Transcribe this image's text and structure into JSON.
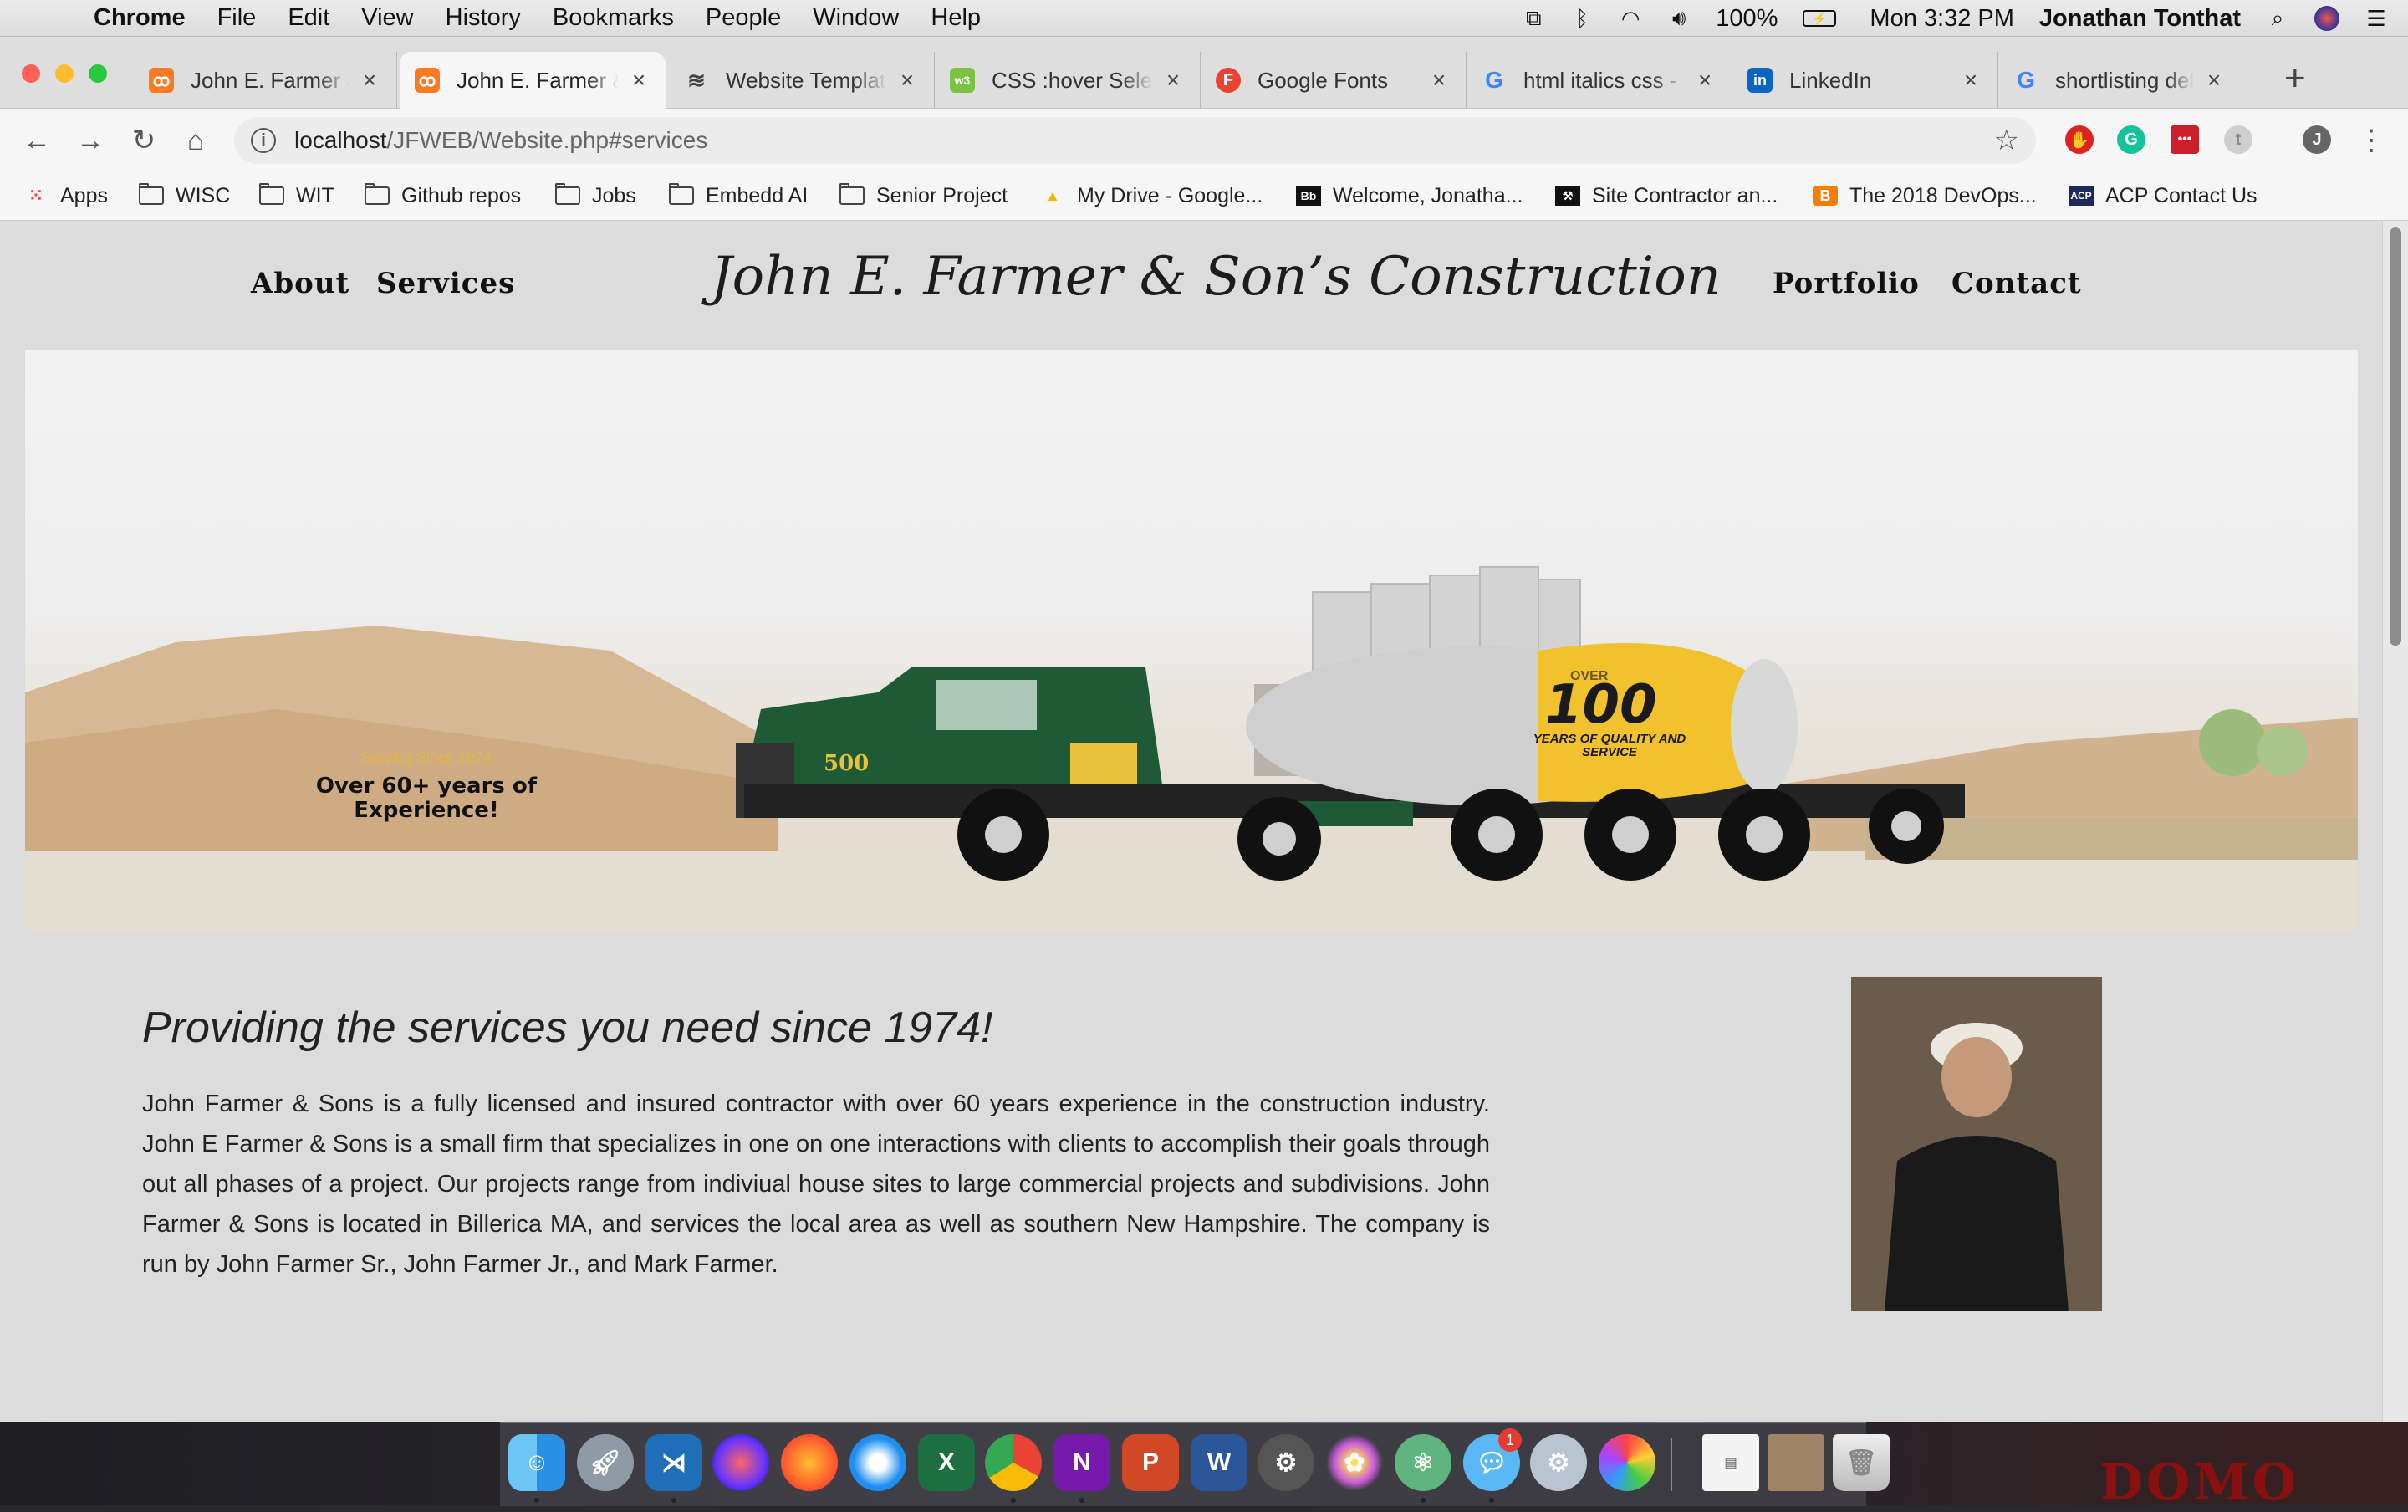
{
  "menubar": {
    "app": "Chrome",
    "items": [
      "File",
      "Edit",
      "View",
      "History",
      "Bookmarks",
      "People",
      "Window",
      "Help"
    ],
    "battery": "100%",
    "clock": "Mon 3:32 PM",
    "user": "Jonathan Tonthat"
  },
  "tabs": [
    {
      "title": "John E. Farmer &",
      "favicon": "xampp-icon",
      "color": "#fb7a24"
    },
    {
      "title": "John E. Farmer &",
      "favicon": "xampp-icon",
      "color": "#fb7a24"
    },
    {
      "title": "Website Templat",
      "favicon": "template-icon",
      "color": "#444444"
    },
    {
      "title": "CSS :hover Selec",
      "favicon": "w3schools-icon",
      "color": "#7cc242"
    },
    {
      "title": "Google Fonts",
      "favicon": "google-fonts-icon",
      "color": "#ea4335"
    },
    {
      "title": "html italics css -",
      "favicon": "google-icon",
      "color": "#4285f4"
    },
    {
      "title": "LinkedIn",
      "favicon": "linkedin-icon",
      "color": "#0a66c2"
    },
    {
      "title": "shortlisting defin",
      "favicon": "google-icon",
      "color": "#4285f4"
    }
  ],
  "address": {
    "host": "localhost",
    "path": "/JFWEB/Website.php#services"
  },
  "bookmarks": [
    {
      "label": "Apps",
      "icon": "apps-grid-icon"
    },
    {
      "label": "WISC",
      "icon": "folder-icon"
    },
    {
      "label": "WIT",
      "icon": "folder-icon"
    },
    {
      "label": "Github repos",
      "icon": "folder-icon"
    },
    {
      "label": "Jobs",
      "icon": "folder-icon"
    },
    {
      "label": "Embedd AI",
      "icon": "folder-icon"
    },
    {
      "label": "Senior Project",
      "icon": "folder-icon"
    },
    {
      "label": "My Drive - Google...",
      "icon": "google-drive-icon"
    },
    {
      "label": "Welcome, Jonatha...",
      "icon": "blackboard-icon"
    },
    {
      "label": "Site Contractor an...",
      "icon": "site-icon"
    },
    {
      "label": "The 2018 DevOps...",
      "icon": "blogger-icon"
    },
    {
      "label": "ACP Contact Us",
      "icon": "acp-icon"
    }
  ],
  "site": {
    "nav_left": [
      "About",
      "Services"
    ],
    "title": "John E. Farmer & Son’s Construction",
    "nav_right": [
      "Portfolio",
      "Contact"
    ],
    "hero": {
      "serving": "-Serving Since 1974-",
      "overlay": "Over 60+ years of Experience!",
      "truck_number": "500",
      "drum_big": "100",
      "drum_small_top": "OVER",
      "drum_small_bottom": "YEARS OF QUALITY AND SERVICE"
    },
    "headline": "Providing the services you need since 1974!",
    "body": "John Farmer & Sons is a fully licensed and insured contractor with over 60 years experience in the construction industry. John E Farmer & Sons is a small firm that specializes in one on one interactions with clients to accomplish their goals through out all phases of a project. Our projects range from indiviual house sites to large commercial projects and subdivisions. John Farmer & Sons is located in Billerica MA, and services the local area as well as southern New Hampshire. The company is run by John Farmer Sr., John Farmer Jr., and Mark Farmer."
  },
  "dock": [
    "finder-icon",
    "launchpad-icon",
    "vscode-icon",
    "siri-icon",
    "firefox-icon",
    "safari-icon",
    "excel-icon",
    "chrome-icon",
    "onenote-icon",
    "powerpoint-icon",
    "word-icon",
    "system-prefs-icon",
    "flower-app-icon",
    "atom-icon",
    "messages-icon",
    "settings-icon",
    "photos-icon"
  ],
  "dock_badge": "1",
  "desktop_text": "DOMO"
}
